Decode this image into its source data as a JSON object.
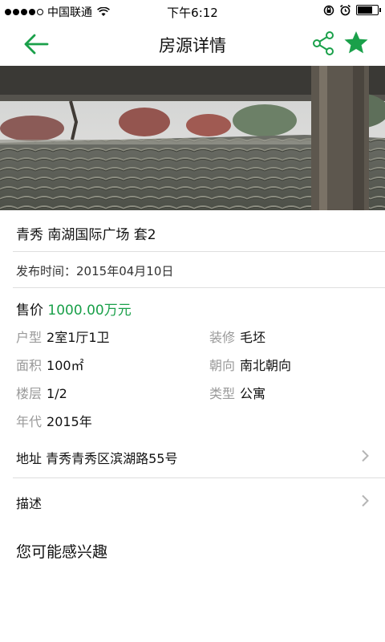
{
  "status_bar": {
    "carrier": "中国联通",
    "time": "下午6:12",
    "signal_icon": "signal-dots-icon",
    "wifi_icon": "wifi-icon",
    "battery_level": 0.75
  },
  "nav": {
    "title": "房源详情",
    "back_icon": "arrow-left-icon",
    "share_icon": "share-icon",
    "favorite_icon": "star-icon",
    "accent_color": "#1aa04a"
  },
  "listing": {
    "title": "青秀  南湖国际广场  套2",
    "publish_label": "发布时间：",
    "publish_date": "2015年04月10日",
    "price_label": "售价",
    "price_value": "1000.00万元",
    "attributes": {
      "layout": {
        "key": "户型",
        "value": "2室1厅1卫"
      },
      "decoration": {
        "key": "装修",
        "value": "毛坯"
      },
      "area": {
        "key": "面积",
        "value": "100㎡"
      },
      "orientation": {
        "key": "朝向",
        "value": "南北朝向"
      },
      "floor": {
        "key": "楼层",
        "value": "1/2"
      },
      "type": {
        "key": "类型",
        "value": "公寓"
      },
      "year": {
        "key": "年代",
        "value": "2015年"
      }
    },
    "address_label": "地址",
    "address_value": "青秀青秀区滨湖路55号",
    "description_label": "描述"
  },
  "interest_title": "您可能感兴趣"
}
